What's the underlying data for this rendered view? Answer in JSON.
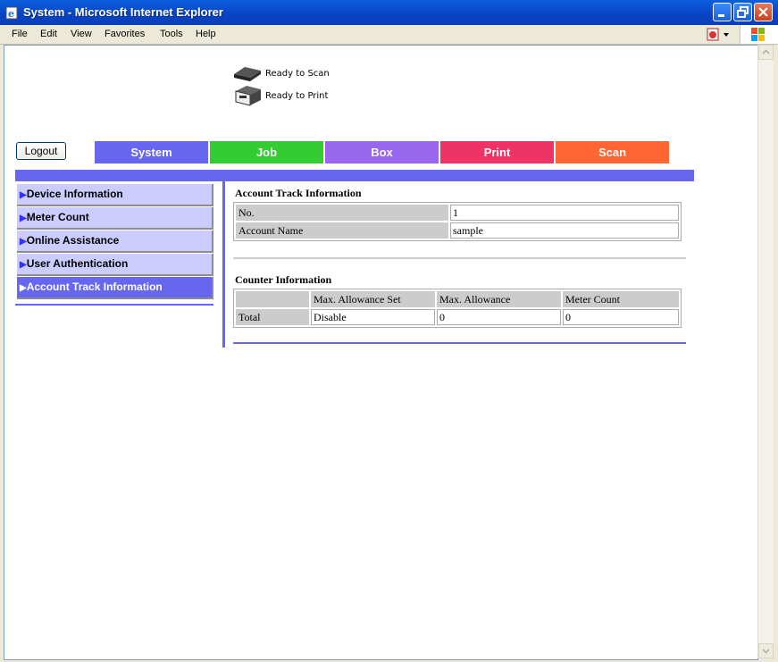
{
  "window": {
    "title": "System - Microsoft Internet Explorer"
  },
  "menu": [
    "File",
    "Edit",
    "View",
    "Favorites",
    "Tools",
    "Help"
  ],
  "device_status": {
    "scan": "Ready to Scan",
    "print": "Ready to Print"
  },
  "logout_label": "Logout",
  "tabs": [
    {
      "label": "System",
      "color": "#6666ee"
    },
    {
      "label": "Job",
      "color": "#33cc33"
    },
    {
      "label": "Box",
      "color": "#9966ee"
    },
    {
      "label": "Print",
      "color": "#ee3366"
    },
    {
      "label": "Scan",
      "color": "#ff6633"
    }
  ],
  "sidebar": [
    {
      "label": "Device Information"
    },
    {
      "label": "Meter Count"
    },
    {
      "label": "Online Assistance"
    },
    {
      "label": "User Authentication"
    },
    {
      "label": "Account Track Information",
      "active": true
    }
  ],
  "account_track": {
    "title": "Account Track Information",
    "rows": [
      {
        "label": "No.",
        "value": "1"
      },
      {
        "label": "Account Name",
        "value": "sample"
      }
    ]
  },
  "counter": {
    "title": "Counter Information",
    "headers": [
      "",
      "Max. Allowance Set",
      "Max. Allowance",
      "Meter Count"
    ],
    "rows": [
      [
        "Total",
        "Disable",
        "0",
        "0"
      ]
    ]
  }
}
